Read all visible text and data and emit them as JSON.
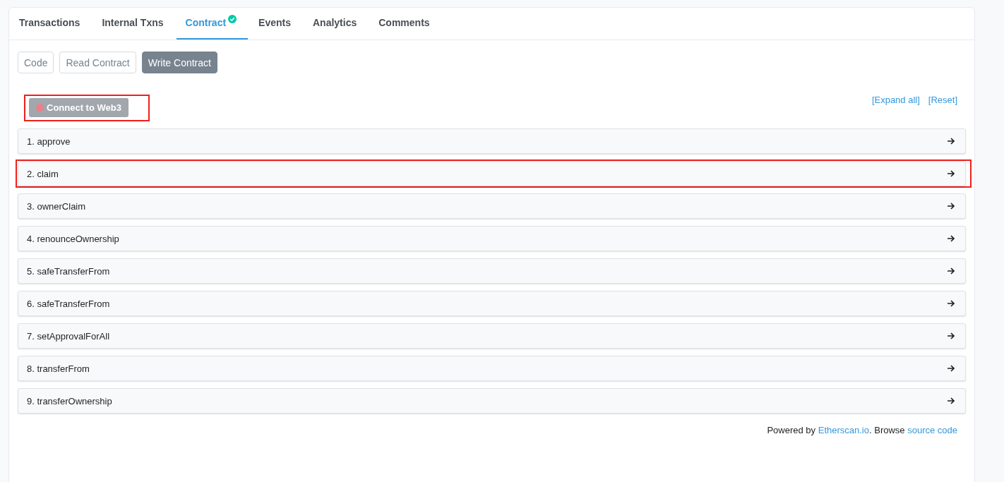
{
  "tabs": [
    {
      "label": "Transactions",
      "selected": false,
      "verified": false
    },
    {
      "label": "Internal Txns",
      "selected": false,
      "verified": false
    },
    {
      "label": "Contract",
      "selected": true,
      "verified": true
    },
    {
      "label": "Events",
      "selected": false,
      "verified": false
    },
    {
      "label": "Analytics",
      "selected": false,
      "verified": false
    },
    {
      "label": "Comments",
      "selected": false,
      "verified": false
    }
  ],
  "subtabs": [
    {
      "label": "Code",
      "selected": false
    },
    {
      "label": "Read Contract",
      "selected": false
    },
    {
      "label": "Write Contract",
      "selected": true
    }
  ],
  "connect_button": {
    "label": "Connect to Web3",
    "connected": false,
    "highlighted": true
  },
  "links": [
    "[Expand all]",
    "[Reset]"
  ],
  "functions": [
    {
      "label": "1. approve",
      "highlighted": false
    },
    {
      "label": "2. claim",
      "highlighted": true
    },
    {
      "label": "3. ownerClaim",
      "highlighted": false
    },
    {
      "label": "4. renounceOwnership",
      "highlighted": false
    },
    {
      "label": "5. safeTransferFrom",
      "highlighted": false
    },
    {
      "label": "6. safeTransferFrom",
      "highlighted": false
    },
    {
      "label": "7. setApprovalForAll",
      "highlighted": false
    },
    {
      "label": "8. transferFrom",
      "highlighted": false
    },
    {
      "label": "9. transferOwnership",
      "highlighted": false
    }
  ],
  "footer": {
    "text_1": "Powered by",
    "link_1": "Etherscan.io",
    "text_2": ". Browse",
    "link_2": "source code"
  }
}
